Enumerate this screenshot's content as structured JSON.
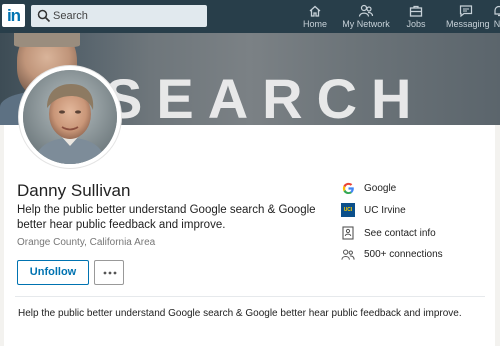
{
  "nav": {
    "logo_text": "in",
    "search_placeholder": "Search",
    "items": [
      {
        "label": "Home",
        "icon": "home-icon"
      },
      {
        "label": "My Network",
        "icon": "network-icon"
      },
      {
        "label": "Jobs",
        "icon": "briefcase-icon"
      },
      {
        "label": "Messaging",
        "icon": "messaging-icon"
      },
      {
        "label": "N",
        "icon": "notifications-icon"
      }
    ]
  },
  "banner": {
    "text": "SEARCH"
  },
  "profile": {
    "name": "Danny Sullivan",
    "headline": "Help the public better understand Google search & Google better hear public feedback and improve.",
    "location": "Orange County, California Area",
    "unfollow_label": "Unfollow",
    "summary": "Help the public better understand Google search & Google better hear public feedback and improve."
  },
  "sidebar": {
    "company": "Google",
    "school": "UC Irvine",
    "school_logo_text": "UCI",
    "contact_label": "See contact info",
    "connections": "500+ connections"
  },
  "colors": {
    "nav_bg": "#283e4a",
    "brand_blue": "#0073b1",
    "page_bg": "#f3f2ef"
  }
}
